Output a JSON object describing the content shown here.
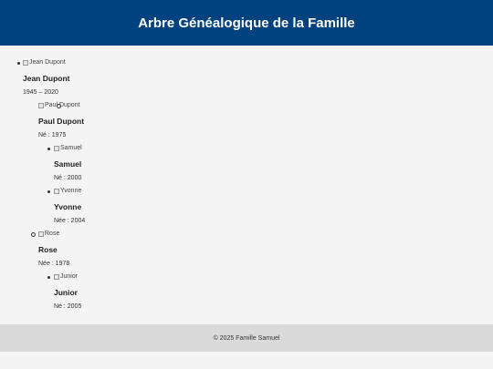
{
  "header": {
    "title": "Arbre Généalogique de la Famille"
  },
  "tree": {
    "root": {
      "img_alt": "Jean Dupont",
      "name": "Jean Dupont",
      "dates": "1945 – 2020",
      "children": [
        {
          "img_alt": "Paul Dupont",
          "name": "Paul Dupont",
          "dates": "Né : 1975",
          "children": [
            {
              "img_alt": "Samuel",
              "name": "Samuel",
              "dates": "Né : 2000"
            },
            {
              "img_alt": "Yvonne",
              "name": "Yvonne",
              "dates": "Née : 2004"
            }
          ]
        },
        {
          "img_alt": "Rose",
          "name": "Rose",
          "dates": "Née : 1978",
          "children": [
            {
              "img_alt": "Junior",
              "name": "Junior",
              "dates": "Né : 2005"
            }
          ]
        }
      ]
    }
  },
  "footer": {
    "text": "© 2025 Famille Samuel"
  }
}
